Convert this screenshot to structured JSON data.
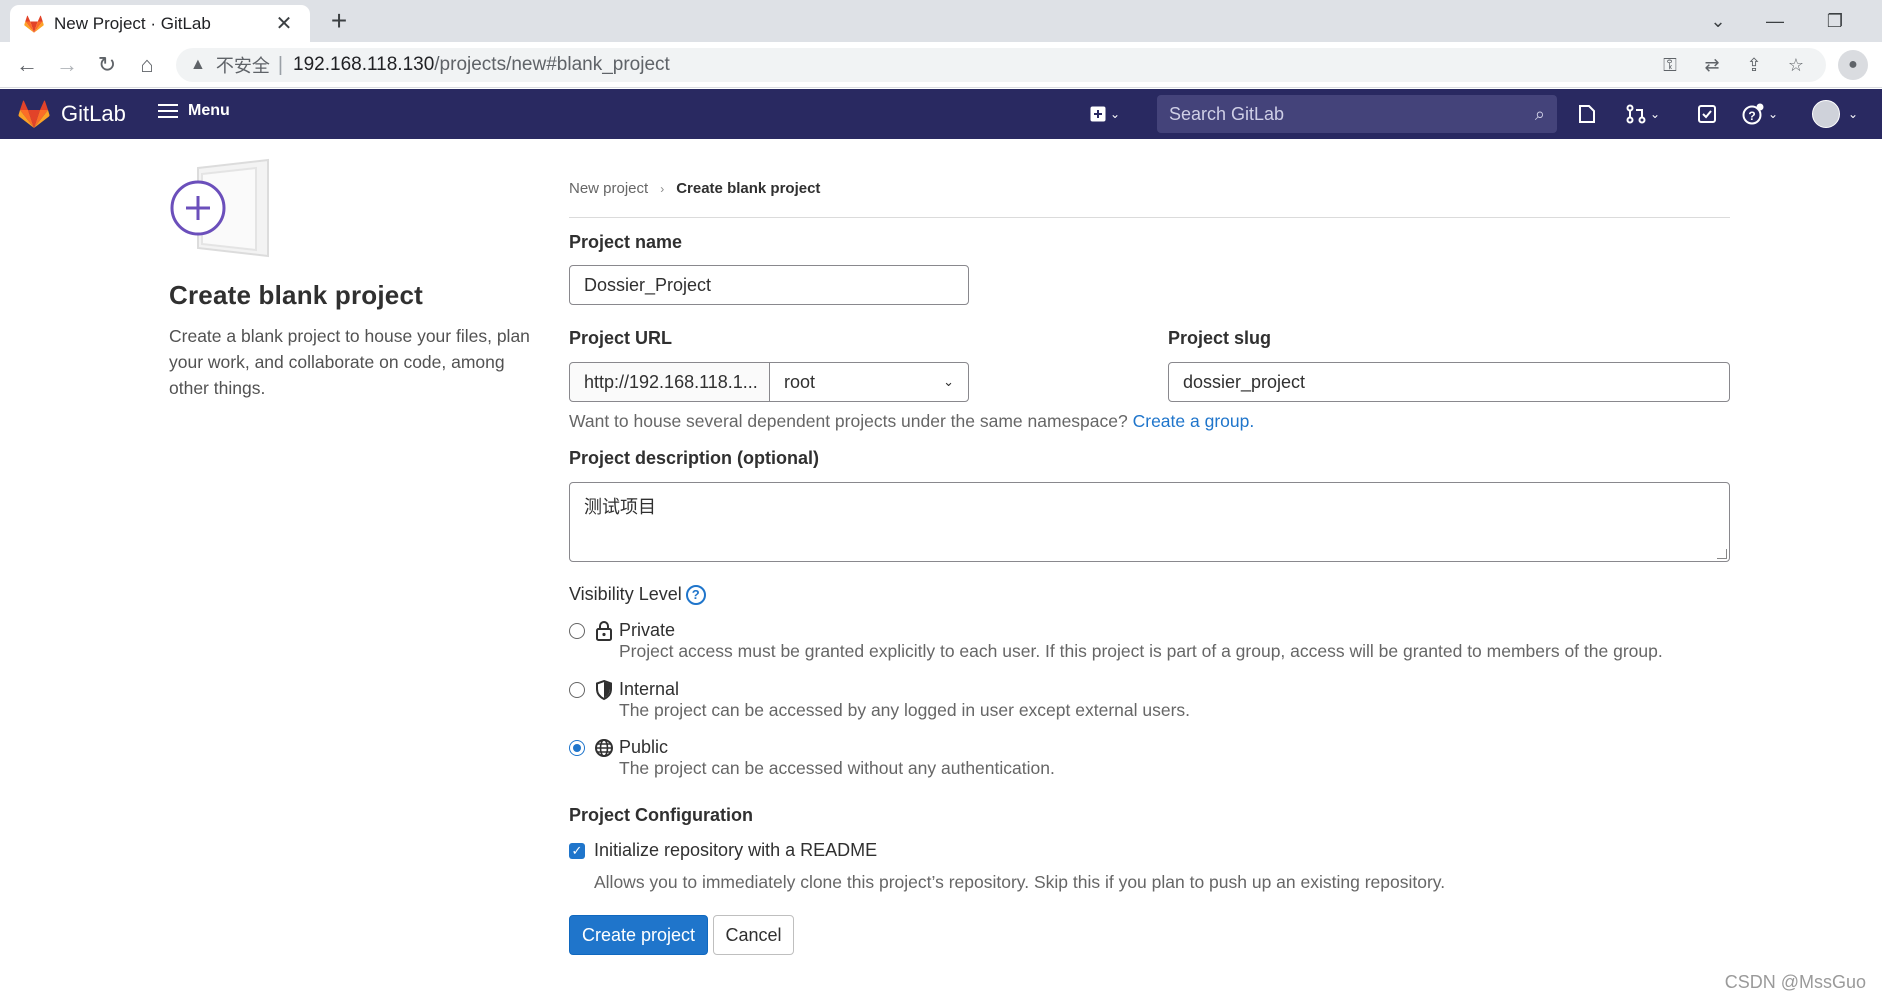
{
  "browser": {
    "tab_title": "New Project · GitLab",
    "tab_close": "✕",
    "new_tab": "+",
    "security_label": "不安全",
    "url_host": "192.168.118.130",
    "url_path": "/projects/new#blank_project"
  },
  "gitlab_header": {
    "brand": "GitLab",
    "menu_label": "Menu",
    "search_placeholder": "Search GitLab"
  },
  "left": {
    "title": "Create blank project",
    "description": "Create a blank project to house your files, plan your work, and collaborate on code, among other things."
  },
  "breadcrumb": {
    "items": [
      "New project",
      "Create blank project"
    ]
  },
  "form": {
    "project_name_label": "Project name",
    "project_name_value": "Dossier_Project",
    "project_url_label": "Project URL",
    "project_url_prefix": "http://192.168.118.1...",
    "namespace_value": "root",
    "project_slug_label": "Project slug",
    "project_slug_value": "dossier_project",
    "namespace_hint": "Want to house several dependent projects under the same namespace?",
    "namespace_hint_link": "Create a group.",
    "description_label": "Project description (optional)",
    "description_value": "测试项目",
    "visibility_label": "Visibility Level",
    "visibility_options": [
      {
        "name": "Private",
        "description": "Project access must be granted explicitly to each user. If this project is part of a group, access will be granted to members of the group.",
        "selected": false,
        "icon": "lock-icon"
      },
      {
        "name": "Internal",
        "description": "The project can be accessed by any logged in user except external users.",
        "selected": false,
        "icon": "shield-icon"
      },
      {
        "name": "Public",
        "description": "The project can be accessed without any authentication.",
        "selected": true,
        "icon": "globe-icon"
      }
    ],
    "config_label": "Project Configuration",
    "readme_label": "Initialize repository with a README",
    "readme_desc": "Allows you to immediately clone this project’s repository. Skip this if you plan to push up an existing repository.",
    "readme_checked": true,
    "create_button": "Create project",
    "cancel_button": "Cancel"
  },
  "watermark": "CSDN @MssGuo",
  "colors": {
    "header_bg": "#292961",
    "primary": "#1f75cb",
    "tabbar_bg": "#dee1e6"
  }
}
